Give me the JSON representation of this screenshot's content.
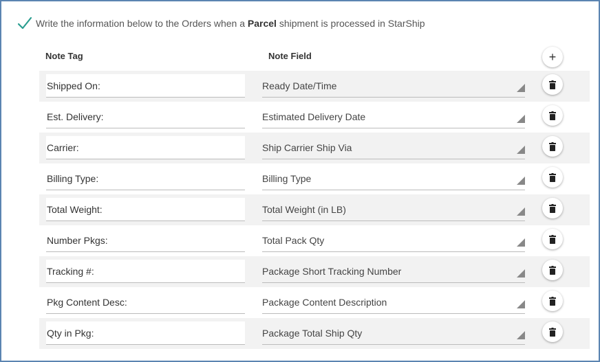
{
  "header": {
    "text_before": "Write the information below to the Orders when a",
    "bold_word": "Parcel",
    "text_after": "shipment is processed in StarShip",
    "check_icon": "checkmark-icon",
    "check_color": "#2a9d8f"
  },
  "columns": {
    "note_tag": "Note Tag",
    "note_field": "Note Field"
  },
  "add_button_label": "+",
  "rows": [
    {
      "tag": "Shipped On:",
      "field": "Ready Date/Time"
    },
    {
      "tag": "Est. Delivery:",
      "field": "Estimated Delivery Date"
    },
    {
      "tag": "Carrier:",
      "field": "Ship Carrier Ship Via"
    },
    {
      "tag": "Billing Type:",
      "field": "Billing Type"
    },
    {
      "tag": "Total Weight:",
      "field": "Total Weight (in LB)"
    },
    {
      "tag": "Number Pkgs:",
      "field": "Total Pack Qty"
    },
    {
      "tag": "Tracking #:",
      "field": "Package Short Tracking Number"
    },
    {
      "tag": "Pkg Content Desc:",
      "field": "Package Content Description"
    },
    {
      "tag": "Qty in Pkg:",
      "field": "Package Total Ship Qty"
    }
  ]
}
